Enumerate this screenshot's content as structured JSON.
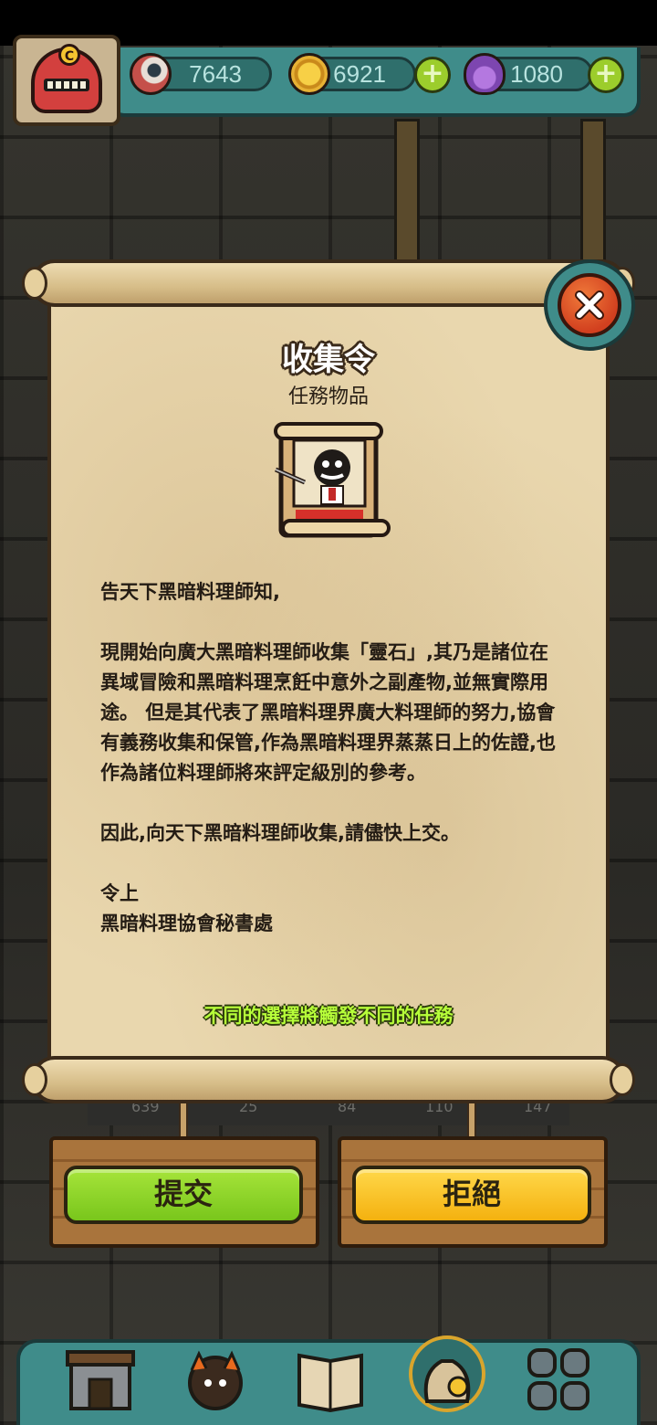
{
  "resources": {
    "eyes": "7643",
    "coins": "6921",
    "potions": "1080"
  },
  "dialog": {
    "title": "收集令",
    "subtitle": "任務物品",
    "paragraphs": [
      "告天下黑暗料理師知,",
      "現開始向廣大黑暗料理師收集「靈石」,其乃是諸位在異域冒險和黑暗料理烹飪中意外之副產物,並無實際用途。 但是其代表了黑暗料理界廣大料理師的努力,協會有義務收集和保管,作為黑暗料理界蒸蒸日上的佐證,也作為諸位料理師將來評定級別的參考。",
      "因此,向天下黑暗料理師收集,請儘快上交。",
      "令上",
      "黑暗料理協會秘書處"
    ],
    "hint": "不同的選擇將觸發不同的任務"
  },
  "buttons": {
    "submit": "提交",
    "refuse": "拒絕"
  },
  "background_stats": [
    "639",
    "25",
    "84",
    "110",
    "147"
  ],
  "icons": {
    "close": "close-x-icon",
    "item": "wanted-scroll-icon"
  },
  "colors": {
    "accent_teal": "#3f8c8a",
    "submit_green": "#8fd42a",
    "refuse_yellow": "#f8c423",
    "hint_green": "#b7ff3a"
  }
}
